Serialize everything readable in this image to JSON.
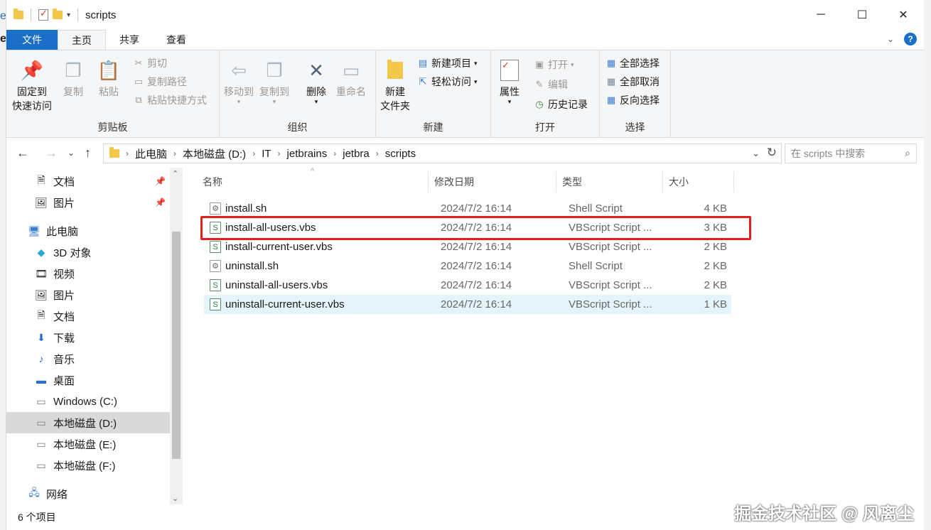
{
  "window": {
    "title": "scripts",
    "controls": {
      "minimize": "─",
      "maximize": "☐",
      "close": "✕"
    }
  },
  "tabs": [
    {
      "label": "文件"
    },
    {
      "label": "主页"
    },
    {
      "label": "共享"
    },
    {
      "label": "查看"
    }
  ],
  "ribbon": {
    "clipboard": {
      "label": "剪贴板",
      "pin_line1": "固定到",
      "pin_line2": "快速访问",
      "copy": "复制",
      "paste": "粘贴",
      "cut": "剪切",
      "copy_path": "复制路径",
      "paste_shortcut": "粘贴快捷方式"
    },
    "organize": {
      "label": "组织",
      "move_to": "移动到",
      "copy_to": "复制到",
      "delete": "删除",
      "rename": "重命名"
    },
    "new": {
      "label": "新建",
      "new_folder_line1": "新建",
      "new_folder_line2": "文件夹",
      "new_item": "新建项目",
      "easy_access": "轻松访问"
    },
    "open": {
      "label": "打开",
      "properties": "属性",
      "open": "打开",
      "edit": "编辑",
      "history": "历史记录"
    },
    "select": {
      "label": "选择",
      "select_all": "全部选择",
      "select_none": "全部取消",
      "invert": "反向选择"
    }
  },
  "address": {
    "crumbs": [
      "此电脑",
      "本地磁盘 (D:)",
      "IT",
      "jetbrains",
      "jetbra",
      "scripts"
    ],
    "search_placeholder": "在 scripts 中搜索"
  },
  "nav": {
    "items": [
      {
        "label": "文档",
        "icon": "document-icon"
      },
      {
        "label": "图片",
        "icon": "picture-icon"
      },
      {
        "label": "此电脑",
        "icon": "computer-icon"
      },
      {
        "label": "3D 对象",
        "icon": "cube-icon"
      },
      {
        "label": "视频",
        "icon": "video-icon"
      },
      {
        "label": "图片",
        "icon": "picture-icon"
      },
      {
        "label": "文档",
        "icon": "document-icon"
      },
      {
        "label": "下载",
        "icon": "download-icon"
      },
      {
        "label": "音乐",
        "icon": "music-icon"
      },
      {
        "label": "桌面",
        "icon": "desktop-icon"
      },
      {
        "label": "Windows (C:)",
        "icon": "drive-icon"
      },
      {
        "label": "本地磁盘 (D:)",
        "icon": "drive-icon"
      },
      {
        "label": "本地磁盘 (E:)",
        "icon": "drive-icon"
      },
      {
        "label": "本地磁盘 (F:)",
        "icon": "drive-icon"
      },
      {
        "label": "网络",
        "icon": "network-icon"
      }
    ]
  },
  "columns": {
    "name": "名称",
    "date": "修改日期",
    "type": "类型",
    "size": "大小"
  },
  "files": [
    {
      "name": "install.sh",
      "date": "2024/7/2 16:14",
      "type": "Shell Script",
      "size": "4 KB"
    },
    {
      "name": "install-all-users.vbs",
      "date": "2024/7/2 16:14",
      "type": "VBScript Script ...",
      "size": "3 KB"
    },
    {
      "name": "install-current-user.vbs",
      "date": "2024/7/2 16:14",
      "type": "VBScript Script ...",
      "size": "2 KB"
    },
    {
      "name": "uninstall.sh",
      "date": "2024/7/2 16:14",
      "type": "Shell Script",
      "size": "2 KB"
    },
    {
      "name": "uninstall-all-users.vbs",
      "date": "2024/7/2 16:14",
      "type": "VBScript Script ...",
      "size": "2 KB"
    },
    {
      "name": "uninstall-current-user.vbs",
      "date": "2024/7/2 16:14",
      "type": "VBScript Script ...",
      "size": "1 KB"
    }
  ],
  "status": {
    "count": "6 个项目"
  },
  "watermark": "掘金技术社区 @ 风离尘",
  "colors": {
    "accent": "#1a6fc9",
    "highlight_box": "#e21f1f",
    "row_hover": "#e5f3fb",
    "nav_selected": "#d9d9d9"
  }
}
